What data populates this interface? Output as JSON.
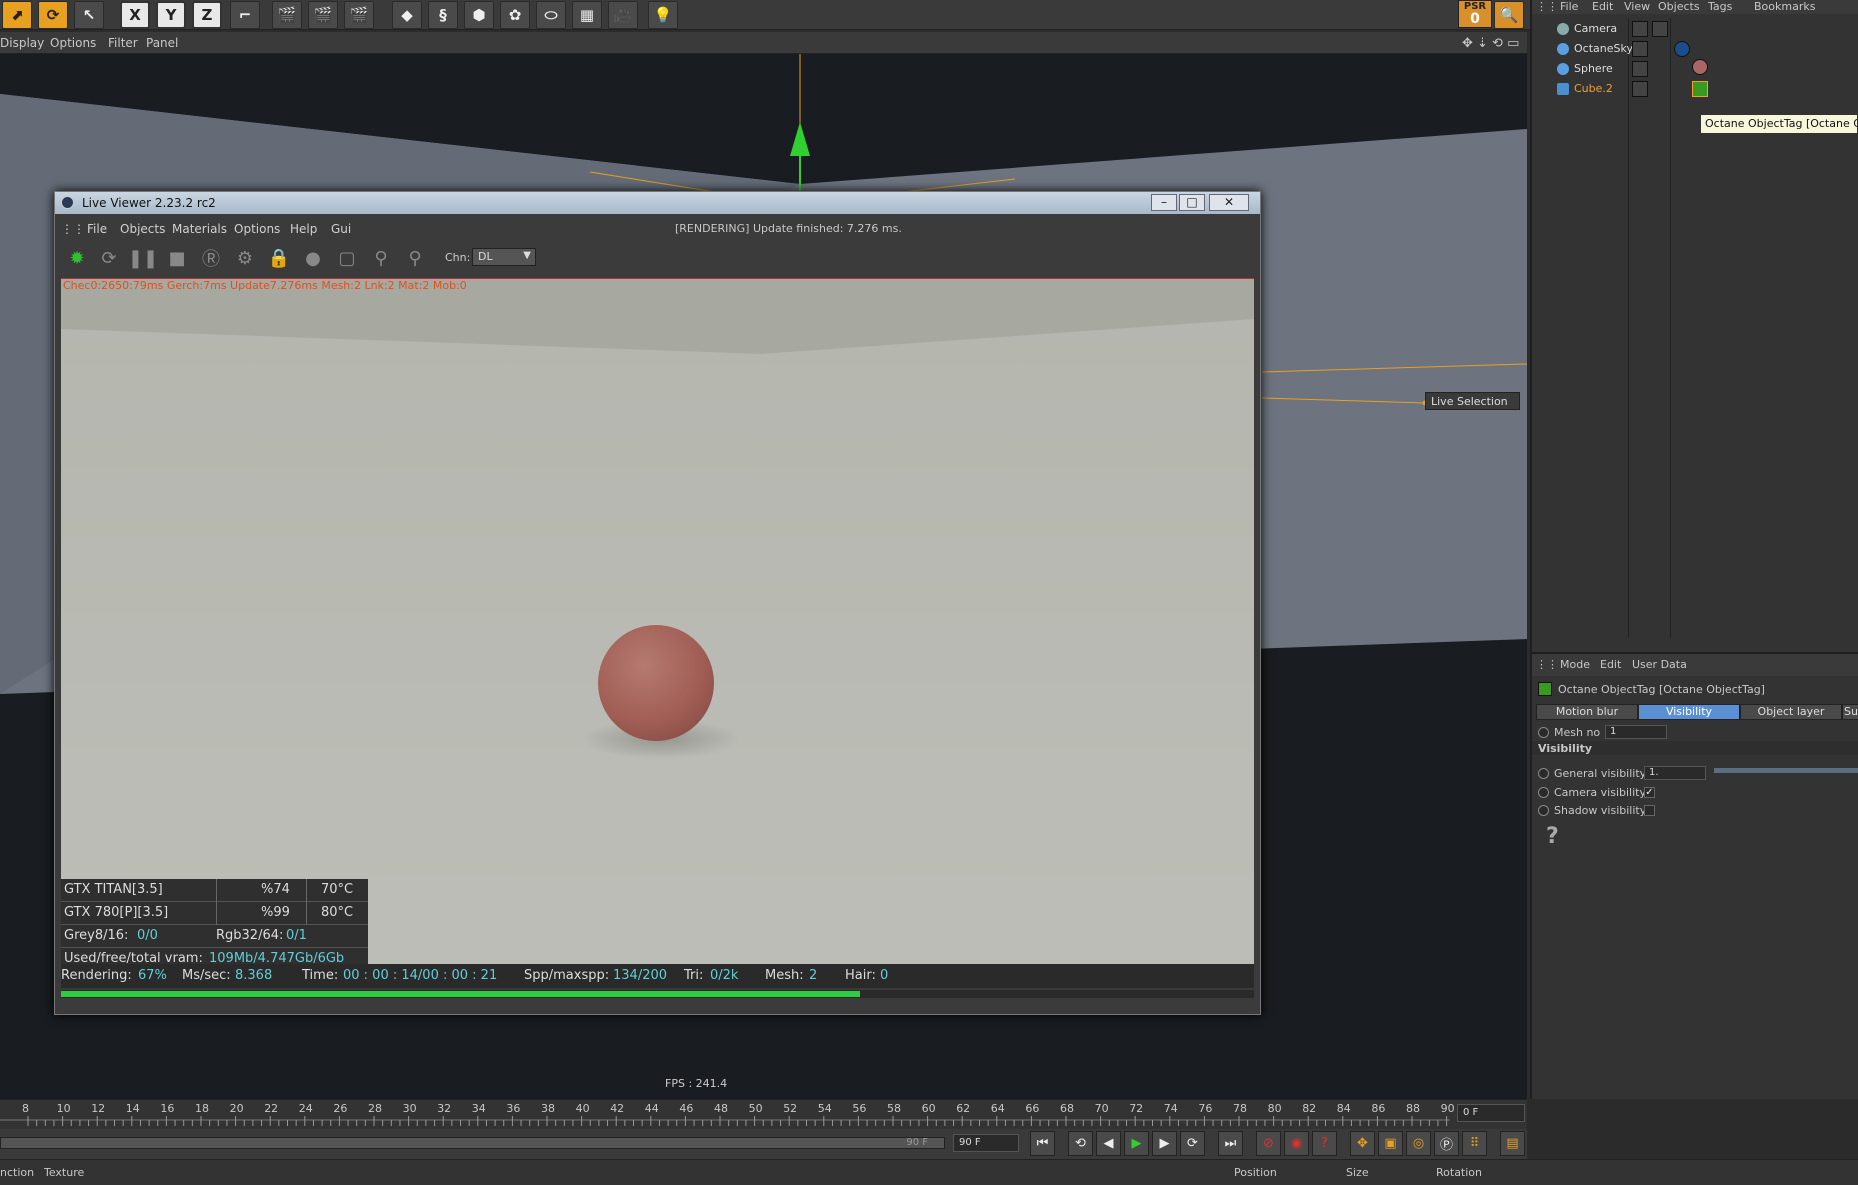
{
  "top_toolbar": {
    "axis_x": "X",
    "axis_y": "Y",
    "axis_z": "Z",
    "psr_label": "PSR",
    "psr_value": "0"
  },
  "viewport_menu": {
    "items": [
      "Display",
      "Options",
      "Filter",
      "Panel"
    ]
  },
  "viewport": {
    "fps": "FPS : 241.4",
    "live_selection": "Live Selection"
  },
  "object_manager": {
    "menu": [
      "File",
      "Edit",
      "View",
      "Objects",
      "Tags",
      "Bookmarks"
    ],
    "objects": [
      {
        "name": "Camera"
      },
      {
        "name": "OctaneSky"
      },
      {
        "name": "Sphere"
      },
      {
        "name": "Cube.2"
      }
    ],
    "tooltip": "Octane ObjectTag [Octane ObjectTag]"
  },
  "attribute_manager": {
    "menu": [
      "Mode",
      "Edit",
      "User Data"
    ],
    "header": "Octane ObjectTag [Octane ObjectTag]",
    "tabs": [
      "Motion blur",
      "Visibility",
      "Object layer",
      "Su"
    ],
    "selected_tab": "Visibility",
    "mesh_no_label": "Mesh no",
    "mesh_no_value": "1",
    "section": "Visibility",
    "general_visibility_label": "General visibility",
    "general_visibility_value": "1.",
    "camera_visibility_label": "Camera visibility",
    "camera_visibility_checked": "✓",
    "shadow_visibility_label": "Shadow visibility",
    "help_glyph": "?"
  },
  "live_viewer": {
    "title": "Live Viewer 2.23.2 rc2",
    "menu": [
      "File",
      "Objects",
      "Materials",
      "Options",
      "Help",
      "Gui"
    ],
    "status": "[RENDERING] Update finished: 7.276 ms.",
    "chn_label": "Chn:",
    "chn_value": "DL",
    "gpus": [
      {
        "name": "GTX TITAN[3.5]",
        "usage": "%74",
        "temp": "70°C"
      },
      {
        "name": "GTX 780[P][3.5]",
        "usage": "%99",
        "temp": "80°C"
      }
    ],
    "grey_label": "Grey8/16:",
    "grey_value": "0/0",
    "rgb_label": "Rgb32/64:",
    "rgb_value": "0/1",
    "vram_label": "Used/free/total vram:",
    "vram_value": "109Mb/4.747Gb/6Gb",
    "stats": {
      "rendering_label": "Rendering:",
      "rendering_value": "67%",
      "mssec_label": "Ms/sec:",
      "mssec_value": "8.368",
      "time_label": "Time:",
      "time_value": "00 : 00 : 14/00 : 00 : 21",
      "spp_label": "Spp/maxspp:",
      "spp_value": "134/200",
      "tri_label": "Tri:",
      "tri_value": "0/2k",
      "mesh_label": "Mesh:",
      "mesh_value": "2",
      "hair_label": "Hair:",
      "hair_value": "0"
    },
    "progress": 0.67
  },
  "timeline": {
    "ticks": [
      "8",
      "10",
      "12",
      "14",
      "16",
      "18",
      "20",
      "22",
      "24",
      "26",
      "28",
      "30",
      "32",
      "34",
      "36",
      "38",
      "40",
      "42",
      "44",
      "46",
      "48",
      "50",
      "52",
      "54",
      "56",
      "58",
      "60",
      "62",
      "64",
      "66",
      "68",
      "70",
      "72",
      "74",
      "76",
      "78",
      "80",
      "82",
      "84",
      "86",
      "88",
      "90"
    ],
    "frame_field": "0 F",
    "end_label": "90 F",
    "end_field": "90 F"
  },
  "bottom_strip": {
    "items": [
      "nction",
      "Texture",
      "Position",
      "Size",
      "Rotation"
    ]
  }
}
